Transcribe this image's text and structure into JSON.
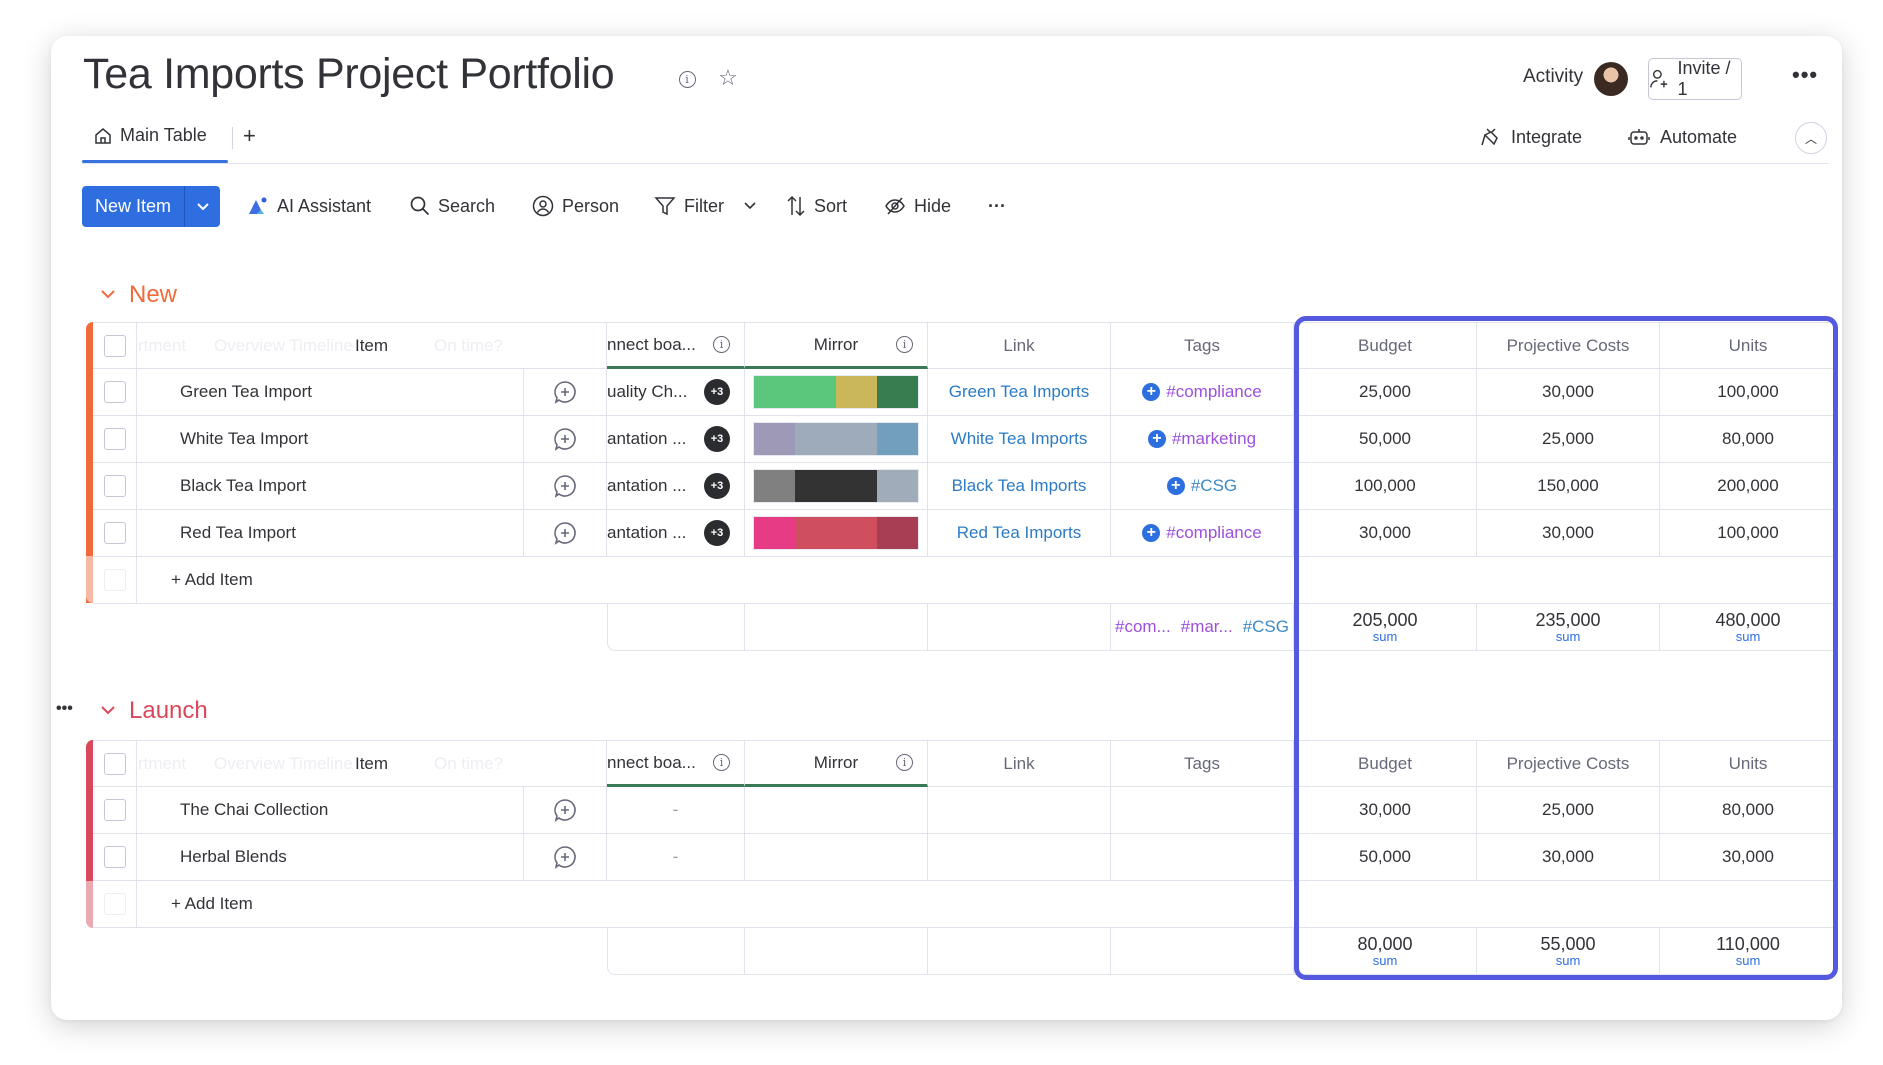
{
  "header": {
    "title": "Tea Imports Project Portfolio",
    "activity_label": "Activity",
    "invite_label": "Invite / 1",
    "more_label": "•••"
  },
  "tabs": {
    "main_tab_label": "Main Table",
    "add_tab_label": "+",
    "integrate_label": "Integrate",
    "automate_label": "Automate",
    "collapse_label": "^"
  },
  "toolbar": {
    "new_item_label": "New Item",
    "ai_assistant_label": "AI Assistant",
    "search_label": "Search",
    "person_label": "Person",
    "filter_label": "Filter",
    "sort_label": "Sort",
    "hide_label": "Hide",
    "more_label": "···"
  },
  "columns": {
    "ghost_department": "rtment",
    "ghost_timeline": "Overview Timeline",
    "ghost_ontime": "On time?",
    "item": "Item",
    "connect": "nnect boa...",
    "mirror": "Mirror",
    "link": "Link",
    "tags": "Tags",
    "budget": "Budget",
    "projective_costs": "Projective Costs",
    "units": "Units"
  },
  "colors": {
    "accent": "#2f6ee0",
    "highlight_border": "#5559df",
    "group_new": "#f06a3a",
    "group_launch": "#d9485a",
    "tag_purple": "#9d50dd",
    "tag_blue": "#3d8ac4",
    "link_blue": "#2c7bc4"
  },
  "groups": [
    {
      "title": "New",
      "add_item_label": "+ Add Item",
      "rows": [
        {
          "item": "Green Tea Import",
          "connect": "uality Ch...",
          "connect_more": "+3",
          "mirror": [
            {
              "color": "#5bc77c",
              "fraction": 0.5
            },
            {
              "color": "#c9b75a",
              "fraction": 0.25
            },
            {
              "color": "#377d50",
              "fraction": 0.25
            }
          ],
          "link": "Green Tea Imports",
          "tag": "#compliance",
          "tag_color": "#9d50dd",
          "budget": "25,000",
          "projective_costs": "30,000",
          "units": "100,000"
        },
        {
          "item": "White Tea Import",
          "connect": "antation ...",
          "connect_more": "+3",
          "mirror": [
            {
              "color": "#9d99b7",
              "fraction": 0.25
            },
            {
              "color": "#9eabba",
              "fraction": 0.5
            },
            {
              "color": "#729fbb",
              "fraction": 0.25
            }
          ],
          "link": "White Tea Imports",
          "tag": "#marketing",
          "tag_color": "#9d50dd",
          "budget": "50,000",
          "projective_costs": "25,000",
          "units": "80,000"
        },
        {
          "item": "Black Tea Import",
          "connect": "antation ...",
          "connect_more": "+3",
          "mirror": [
            {
              "color": "#808080",
              "fraction": 0.25
            },
            {
              "color": "#333333",
              "fraction": 0.5
            },
            {
              "color": "#a0acba",
              "fraction": 0.25
            }
          ],
          "link": "Black Tea Imports",
          "tag": "#CSG",
          "tag_color": "#3d8ac4",
          "budget": "100,000",
          "projective_costs": "150,000",
          "units": "200,000"
        },
        {
          "item": "Red Tea Import",
          "connect": "antation ...",
          "connect_more": "+3",
          "mirror": [
            {
              "color": "#e83b86",
              "fraction": 0.25
            },
            {
              "color": "#d04f5e",
              "fraction": 0.5
            },
            {
              "color": "#a83e53",
              "fraction": 0.25
            }
          ],
          "link": "Red Tea Imports",
          "tag": "#compliance",
          "tag_color": "#9d50dd",
          "budget": "30,000",
          "projective_costs": "30,000",
          "units": "100,000"
        }
      ],
      "summary": {
        "tags": [
          {
            "text": "#com...",
            "color": "#9d50dd"
          },
          {
            "text": "#mar...",
            "color": "#9d50dd"
          },
          {
            "text": "#CSG",
            "color": "#3d8ac4"
          }
        ],
        "budget": "205,000",
        "projective_costs": "235,000",
        "units": "480,000",
        "label": "sum"
      }
    },
    {
      "title": "Launch",
      "add_item_label": "+ Add Item",
      "rows": [
        {
          "item": "The Chai Collection",
          "connect": "-",
          "budget": "30,000",
          "projective_costs": "25,000",
          "units": "80,000"
        },
        {
          "item": "Herbal Blends",
          "connect": "-",
          "budget": "50,000",
          "projective_costs": "30,000",
          "units": "30,000"
        }
      ],
      "summary": {
        "budget": "80,000",
        "projective_costs": "55,000",
        "units": "110,000",
        "label": "sum"
      }
    }
  ]
}
